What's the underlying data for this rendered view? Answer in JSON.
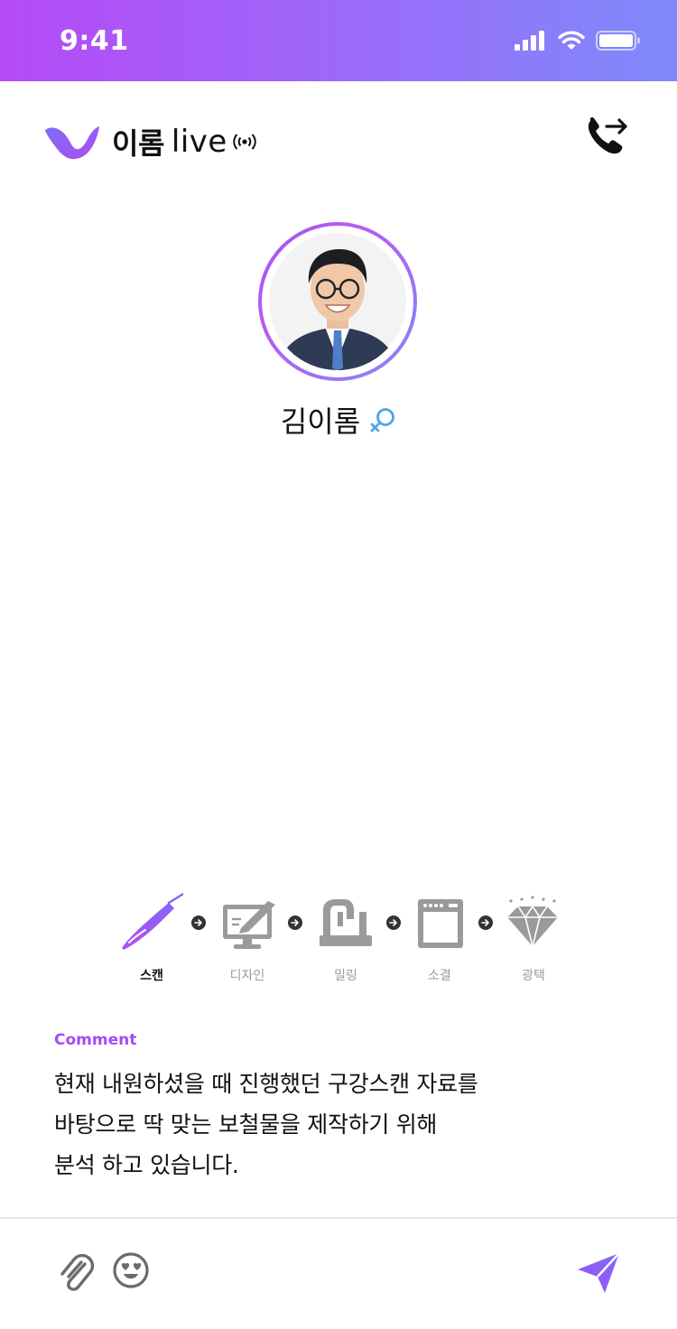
{
  "status_bar": {
    "time": "9:41"
  },
  "header": {
    "logo_text": "이롬",
    "logo_live": "live",
    "icons": {
      "logo": "iroom-logo",
      "broadcast": "broadcast-icon",
      "call": "call-transfer-icon"
    }
  },
  "profile": {
    "name": "김이롬",
    "gender_icon": "female-symbol-icon"
  },
  "steps": [
    {
      "label": "스캔",
      "icon": "scanner-icon",
      "active": true
    },
    {
      "label": "디자인",
      "icon": "design-monitor-icon",
      "active": false
    },
    {
      "label": "밀링",
      "icon": "milling-machine-icon",
      "active": false
    },
    {
      "label": "소결",
      "icon": "sintering-oven-icon",
      "active": false
    },
    {
      "label": "광택",
      "icon": "diamond-icon",
      "active": false
    }
  ],
  "comment": {
    "title": "Comment",
    "lines": [
      "현재 내원하셨을 때 진행했던 구강스캔 자료를",
      "바탕으로 딱 맞는 보철물을 제작하기 위해",
      "분석 하고 있습니다."
    ]
  },
  "bottom_bar": {
    "icons": {
      "attach": "paperclip-icon",
      "emoji": "heart-eyes-emoji-icon",
      "send": "send-icon"
    }
  },
  "colors": {
    "accent": "#a24cf4",
    "gradient_start": "#b54af7",
    "gradient_end": "#7e8afb",
    "inactive": "#9a9a9a"
  }
}
